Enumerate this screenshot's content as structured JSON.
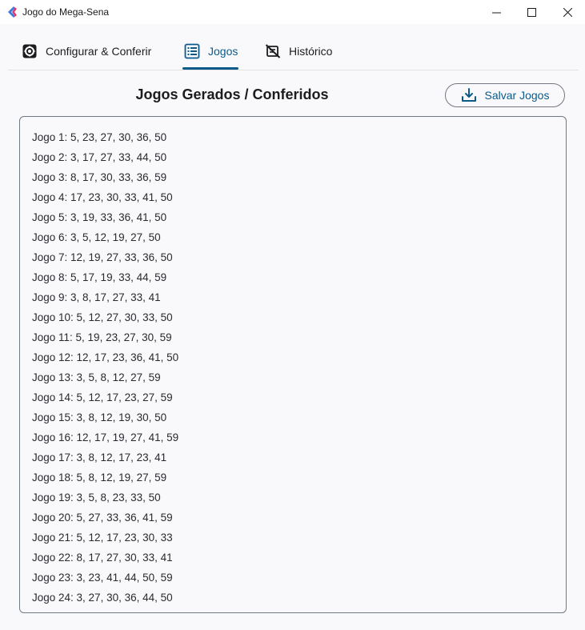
{
  "window": {
    "title": "Jogo do Mega-Sena",
    "accent_color": "#0b5a8a",
    "icon": "mega-sena-logo-icon"
  },
  "tabs": [
    {
      "label": "Configurar & Conferir",
      "icon": "gear-icon",
      "selected": false
    },
    {
      "label": "Jogos",
      "icon": "list-icon",
      "selected": true
    },
    {
      "label": "Histórico",
      "icon": "history-slash-icon",
      "selected": false
    }
  ],
  "header": {
    "title": "Jogos Gerados / Conferidos",
    "save_label": "Salvar Jogos",
    "save_icon": "download-icon"
  },
  "games": [
    "Jogo 1: 5, 23, 27, 30, 36, 50",
    "Jogo 2: 3, 17, 27, 33, 44, 50",
    "Jogo 3: 8, 17, 30, 33, 36, 59",
    "Jogo 4: 17, 23, 30, 33, 41, 50",
    "Jogo 5: 3, 19, 33, 36, 41, 50",
    "Jogo 6: 3, 5, 12, 19, 27, 50",
    "Jogo 7: 12, 19, 27, 33, 36, 50",
    "Jogo 8: 5, 17, 19, 33, 44, 59",
    "Jogo 9: 3, 8, 17, 27, 33, 41",
    "Jogo 10: 5, 12, 27, 30, 33, 50",
    "Jogo 11: 5, 19, 23, 27, 30, 59",
    "Jogo 12: 12, 17, 23, 36, 41, 50",
    "Jogo 13: 3, 5, 8, 12, 27, 59",
    "Jogo 14: 5, 12, 17, 23, 27, 59",
    "Jogo 15: 3, 8, 12, 19, 30, 50",
    "Jogo 16: 12, 17, 19, 27, 41, 59",
    "Jogo 17: 3, 8, 12, 17, 23, 41",
    "Jogo 18: 5, 8, 12, 19, 27, 59",
    "Jogo 19: 3, 5, 8, 23, 33, 50",
    "Jogo 20: 5, 27, 33, 36, 41, 59",
    "Jogo 21: 5, 12, 17, 23, 30, 33",
    "Jogo 22: 8, 17, 27, 30, 33, 41",
    "Jogo 23: 3, 23, 41, 44, 50, 59",
    "Jogo 24: 3, 27, 30, 36, 44, 50"
  ]
}
